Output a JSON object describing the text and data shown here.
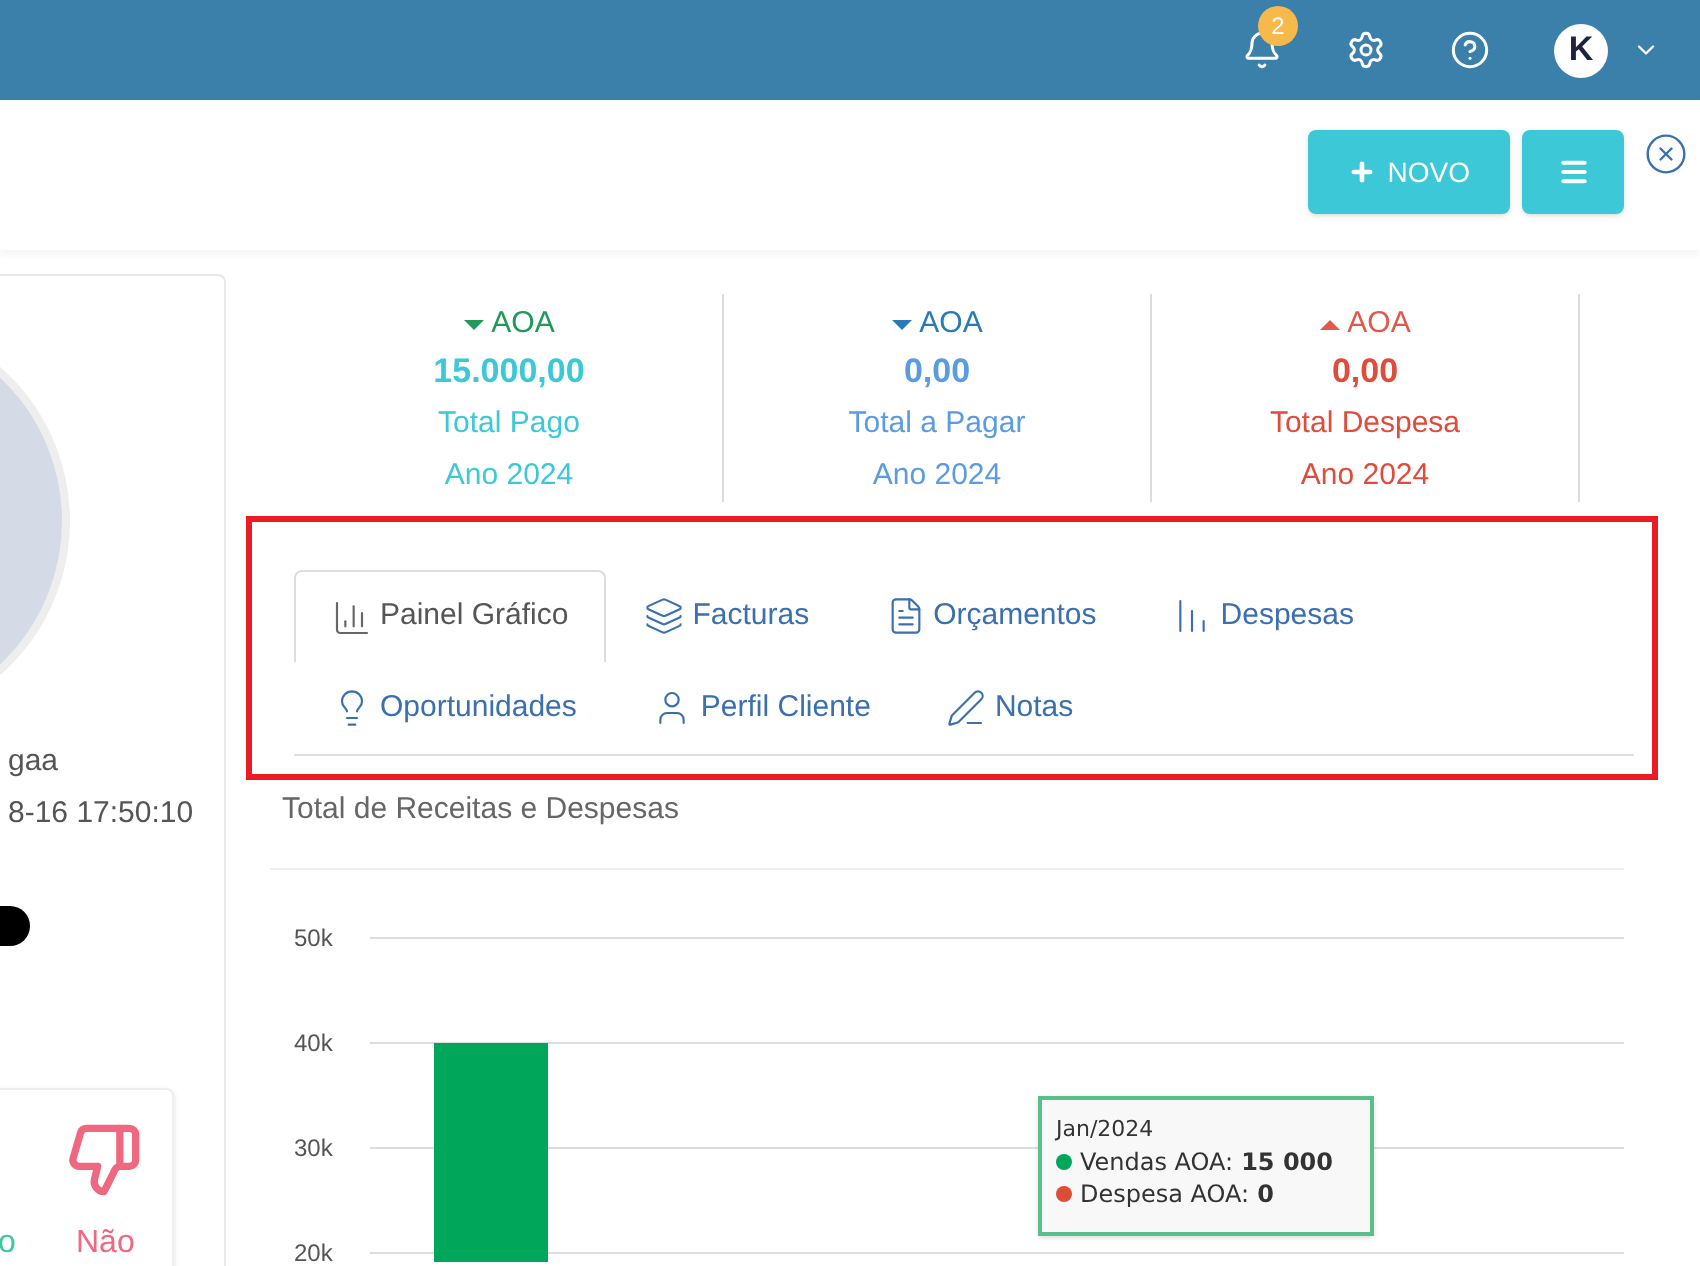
{
  "topbar": {
    "notification_count": "2",
    "avatar_letter": "K"
  },
  "actions": {
    "new_button": "NOVO"
  },
  "profile": {
    "name_fragment": "gaa",
    "date_fragment": "8-16 17:50:10",
    "vote_label_fragment": "o",
    "vote_label": "Não"
  },
  "stats": [
    {
      "kind": "down",
      "currency": {
        "label": "AOA",
        "color": "#1f9a5a"
      },
      "amount": "15.000,00",
      "label": "Total Pago",
      "period": "Ano 2024",
      "color": "#3cc8d6"
    },
    {
      "kind": "down",
      "currency": {
        "label": "AOA",
        "color": "#2a7ab8"
      },
      "amount": "0,00",
      "label": "Total a Pagar",
      "period": "Ano 2024",
      "color": "#5b9be0"
    },
    {
      "kind": "up",
      "currency": {
        "label": "AOA",
        "color": "#e05a4c"
      },
      "amount": "0,00",
      "label": "Total Despesa",
      "period": "Ano 2024",
      "color": "#e04b3c"
    }
  ],
  "tabs": [
    {
      "kind": "chart",
      "label": "Painel Gráfico",
      "selected": true
    },
    {
      "kind": "invoices",
      "label": "Facturas",
      "selected": false
    },
    {
      "kind": "quotes",
      "label": "Orçamentos",
      "selected": false
    },
    {
      "kind": "expenses",
      "label": "Despesas",
      "selected": false
    },
    {
      "kind": "ideas",
      "label": "Oportunidades",
      "selected": false
    },
    {
      "kind": "profile",
      "label": "Perfil Cliente",
      "selected": false
    },
    {
      "kind": "notes",
      "label": "Notas",
      "selected": false
    }
  ],
  "chart": {
    "title": "Total de Receitas e Despesas",
    "chart_data": {
      "type": "bar",
      "series": [
        {
          "color": "#00a65a",
          "values": [
            40000
          ]
        }
      ],
      "ylim": [
        20000,
        50000
      ],
      "yticks": [
        {
          "value": 20000,
          "label": "20k"
        },
        {
          "value": 30000,
          "label": "30k"
        },
        {
          "value": 40000,
          "label": "40k"
        },
        {
          "value": 50000,
          "label": "50k"
        }
      ]
    },
    "tooltip": {
      "title": "Jan/2024",
      "rows": [
        {
          "label": "Vendas AOA:",
          "value": "15 000",
          "color": "#00a65a"
        },
        {
          "label": "Despesa AOA:",
          "value": "0",
          "color": "#dd4b39"
        }
      ]
    }
  }
}
